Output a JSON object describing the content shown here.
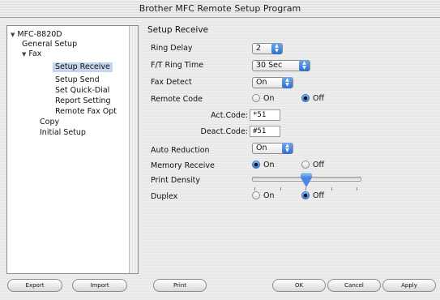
{
  "window": {
    "title": "Brother MFC Remote Setup Program"
  },
  "sidebar": {
    "items": [
      {
        "label": "MFC-8820D",
        "expanded": true,
        "level": 0
      },
      {
        "label": "General Setup",
        "level": 1
      },
      {
        "label": "Fax",
        "expanded": true,
        "level": 1
      },
      {
        "label": "Setup Receive",
        "level": 2,
        "selected": true
      },
      {
        "label": "Setup Send",
        "level": 2
      },
      {
        "label": "Set Quick-Dial",
        "level": 2
      },
      {
        "label": "Report Setting",
        "level": 2
      },
      {
        "label": "Remote Fax Opt",
        "level": 2
      },
      {
        "label": "Copy",
        "level": 1
      },
      {
        "label": "Initial Setup",
        "level": 1
      }
    ]
  },
  "main": {
    "title": "Setup Receive",
    "ring_delay": {
      "label": "Ring Delay",
      "value": "2"
    },
    "ft_ring_time": {
      "label": "F/T Ring Time",
      "value": "30 Sec"
    },
    "fax_detect": {
      "label": "Fax Detect",
      "value": "On"
    },
    "remote_code": {
      "label": "Remote Code",
      "on": "On",
      "off": "Off",
      "selected": "Off"
    },
    "act_code": {
      "label": "Act.Code:",
      "value": "*51"
    },
    "deact_code": {
      "label": "Deact.Code:",
      "value": "#51"
    },
    "auto_reduction": {
      "label": "Auto Reduction",
      "value": "On"
    },
    "memory_receive": {
      "label": "Memory Receive",
      "on": "On",
      "off": "Off",
      "selected": "On"
    },
    "print_density": {
      "label": "Print Density",
      "level_fraction": 0.5
    },
    "duplex": {
      "label": "Duplex",
      "on": "On",
      "off": "Off",
      "selected": "Off"
    }
  },
  "buttons": {
    "export": "Export",
    "import": "Import",
    "print": "Print",
    "ok": "OK",
    "cancel": "Cancel",
    "apply": "Apply"
  },
  "colors": {
    "accent": "#3b7ad9",
    "selection": "#c6d6f0"
  }
}
